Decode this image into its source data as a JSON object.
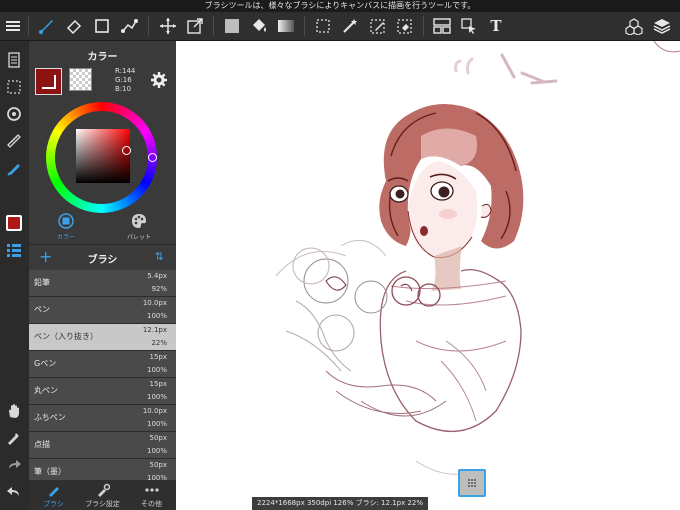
{
  "tip_bar": {
    "text": "ブラシツールは、様々なブラシによりキャンバスに描画を行うツールです。"
  },
  "toolbar": {
    "icons": [
      "menu-icon",
      "brush-tool-icon",
      "eraser-tool-icon",
      "rectangle-tool-icon",
      "connect-tool-icon",
      "move-tool-icon",
      "transform-tool-icon",
      "fill-color-icon",
      "bucket-tool-icon",
      "gradation-tool-icon",
      "select-rect-icon",
      "magic-wand-icon",
      "select-pen-icon",
      "select-eraser-icon",
      "layout-icon",
      "lasso-fill-icon",
      "text-tool-icon",
      "material-icon",
      "layers-icon"
    ],
    "text_tool_glyph": "T"
  },
  "color_panel": {
    "title": "カラー",
    "r": "R:144",
    "g": "G:16",
    "b": "B:10",
    "current_color": "#900f0a",
    "tabs": [
      {
        "label": "カラー"
      },
      {
        "label": "パレット"
      }
    ]
  },
  "brush_panel": {
    "title": "ブラシ",
    "add_glyph": "+",
    "sort_glyph": "⇅",
    "items": [
      {
        "name": "鉛筆",
        "size": "5.4px",
        "opacity": "92%"
      },
      {
        "name": "ペン",
        "size": "10.0px",
        "opacity": "100%"
      },
      {
        "name": "ペン（入り抜き）",
        "size": "12.1px",
        "opacity": "22%"
      },
      {
        "name": "Gペン",
        "size": "15px",
        "opacity": "100%"
      },
      {
        "name": "丸ペン",
        "size": "15px",
        "opacity": "100%"
      },
      {
        "name": "ふちペン",
        "size": "10.0px",
        "opacity": "100%"
      },
      {
        "name": "点描",
        "size": "50px",
        "opacity": "100%"
      },
      {
        "name": "筆（墨）",
        "size": "50px",
        "opacity": "100%"
      }
    ]
  },
  "bottom_tabs": [
    {
      "label": "ブラシ"
    },
    {
      "label": "ブラシ設定"
    },
    {
      "label": "その他"
    }
  ],
  "status_bar": {
    "text": "2224*1668px 350dpi 126% ブラシ: 12.1px 22%"
  },
  "colors": {
    "accent": "#3aa0e8",
    "panel": "#3a3a3a",
    "selected_row": "#c8c8c8"
  }
}
